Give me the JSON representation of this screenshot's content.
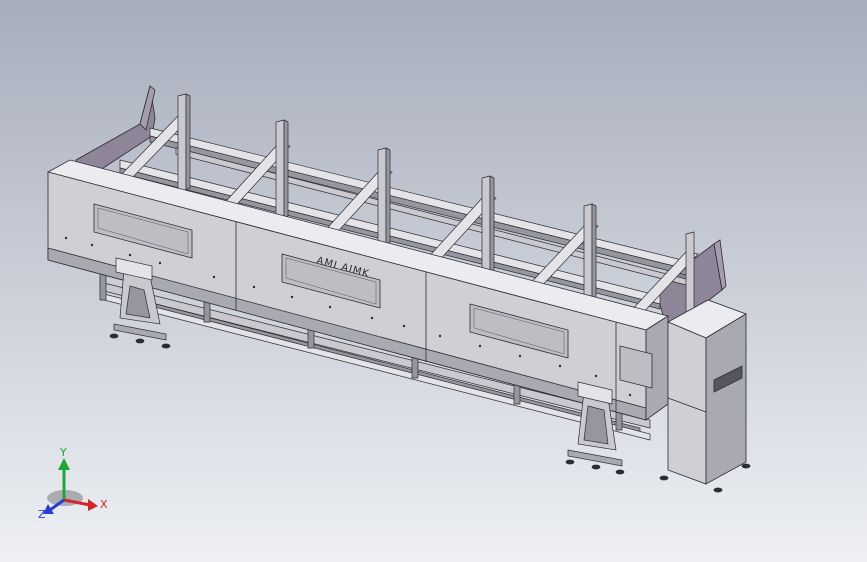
{
  "viewport": {
    "background_top": "#a7adbc",
    "background_bottom": "#eef0f4"
  },
  "model": {
    "nameplate_text": "AMI AIMK",
    "colors": {
      "frame_face": "#c9c9cf",
      "frame_top": "#e4e4e8",
      "frame_dark": "#96969e",
      "panel_face": "#cfcfd4",
      "panel_top": "#ececf0",
      "panel_shadow": "#a9a9b1",
      "guard_purple": "#8f8598",
      "guard_purple_light": "#a59cb0",
      "edge": "#2c2c33",
      "window": "#bdbdc3"
    }
  },
  "triad": {
    "x_label": "X",
    "y_label": "Y",
    "z_label": "Z",
    "x_color": "#d0262c",
    "y_color": "#1fa53a",
    "z_color": "#2b3ccf"
  }
}
